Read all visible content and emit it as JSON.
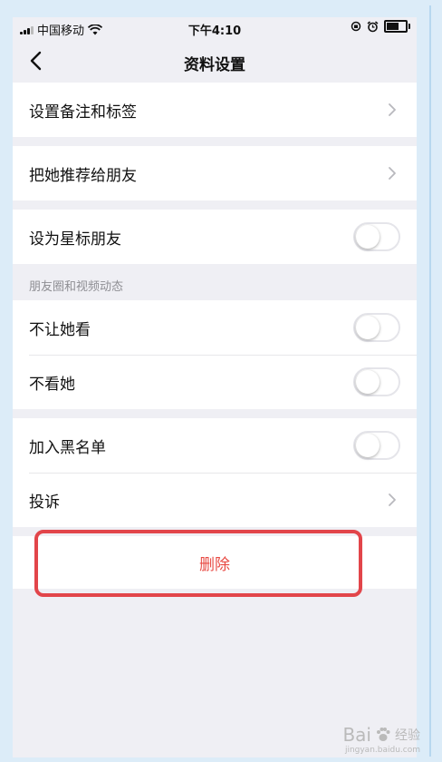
{
  "status": {
    "carrier": "中国移动",
    "time": "下午4:10"
  },
  "nav": {
    "title": "资料设置"
  },
  "sections": {
    "remark": "设置备注和标签",
    "recommend": "把她推荐给朋友",
    "star": "设为星标朋友",
    "moments_header": "朋友圈和视频动态",
    "hide_from": "不让她看",
    "hide_her": "不看她",
    "blacklist": "加入黑名单",
    "report": "投诉"
  },
  "toggles": {
    "star": false,
    "hide_from": false,
    "hide_her": false,
    "blacklist": false
  },
  "delete": {
    "label": "删除",
    "color": "#e84a43"
  },
  "annotation": {
    "highlight_color": "#e2454a"
  },
  "watermark": {
    "brand": "Bai",
    "brand_suffix": "经验",
    "url": "jingyan.baidu.com"
  }
}
